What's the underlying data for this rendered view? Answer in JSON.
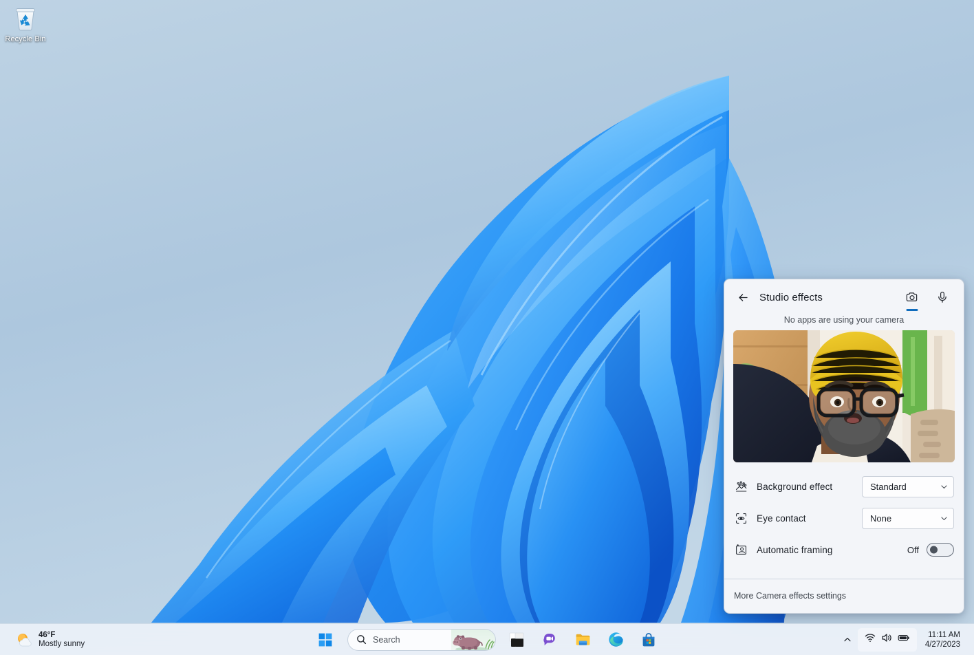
{
  "desktop": {
    "icons": [
      {
        "name": "recycle-bin",
        "label": "Recycle Bin"
      }
    ]
  },
  "studio_effects": {
    "back_label": "back-arrow-icon",
    "title": "Studio effects",
    "tabs": [
      {
        "name": "camera",
        "icon": "camera-icon",
        "selected": true
      },
      {
        "name": "microphone",
        "icon": "microphone-icon",
        "selected": false
      }
    ],
    "status": "No apps are using your camera",
    "preview_alt": "camera-preview",
    "settings": [
      {
        "icon": "background-blur-icon",
        "label": "Background effect",
        "control": "dropdown",
        "value": "Standard"
      },
      {
        "icon": "eye-contact-icon",
        "label": "Eye contact",
        "control": "dropdown",
        "value": "None"
      },
      {
        "icon": "automatic-framing-icon",
        "label": "Automatic framing",
        "control": "toggle",
        "value": "Off"
      }
    ],
    "footer_link": "More Camera effects settings",
    "accent_color": "#0f6cbd"
  },
  "taskbar": {
    "weather": {
      "temperature": "46°F",
      "condition": "Mostly sunny"
    },
    "start": {
      "label": "Start",
      "icon": "windows-logo-icon"
    },
    "search": {
      "placeholder": "Search",
      "icon": "search-icon",
      "mascot": "hippopotamus-illustration"
    },
    "apps": [
      {
        "name": "task-view",
        "label": "Task view",
        "icon": "task-view-icon"
      },
      {
        "name": "chat",
        "label": "Chat",
        "icon": "chat-icon"
      },
      {
        "name": "file-explorer",
        "label": "File Explorer",
        "icon": "folder-icon"
      },
      {
        "name": "edge",
        "label": "Microsoft Edge",
        "icon": "edge-icon"
      },
      {
        "name": "microsoft-store",
        "label": "Microsoft Store",
        "icon": "store-icon"
      }
    ],
    "tray": {
      "chevron": "chevron-up-icon",
      "icons": [
        {
          "name": "wifi",
          "icon": "wifi-icon"
        },
        {
          "name": "volume",
          "icon": "speaker-icon"
        },
        {
          "name": "battery",
          "icon": "battery-icon"
        }
      ],
      "time": "11:11 AM",
      "date": "4/27/2023"
    }
  }
}
